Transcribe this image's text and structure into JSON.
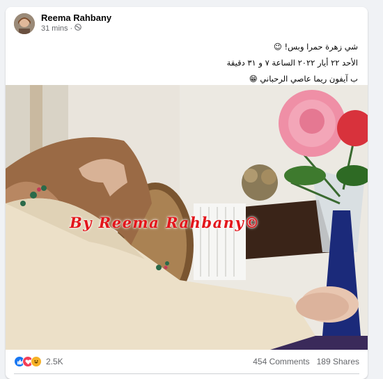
{
  "post": {
    "author": "Reema Rahbany",
    "time": "31 mins",
    "privacy_icon": "globe-icon",
    "lines": [
      "شي زهرة حمرا وبس! 😉",
      "الأحد ٢٢ أيار ٢٠٢٢ الساعة ٧ و ٣١ دقيقة",
      "ب آيفون ريما عاصي الرحباني 😁"
    ],
    "watermark": "By Reema Rahbany©"
  },
  "footer": {
    "reactions": [
      "like-icon",
      "love-icon",
      "haha-icon"
    ],
    "reaction_count": "2.5K",
    "comments": "454 Comments",
    "shares": "189 Shares"
  },
  "colors": {
    "like": "#1877f2",
    "love": "#f33e58",
    "haha": "#f7b125",
    "watermark": "#e3151b"
  }
}
